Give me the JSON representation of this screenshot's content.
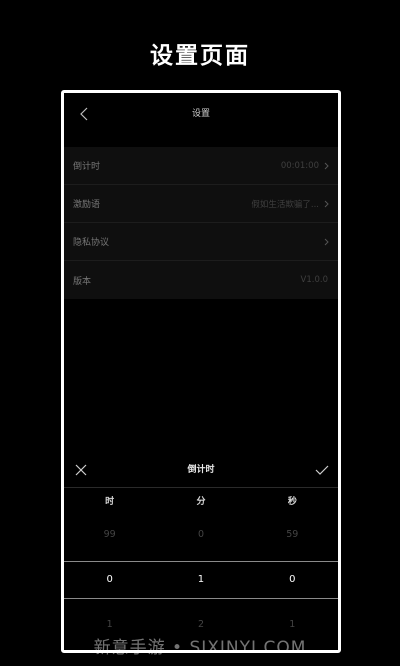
{
  "promo": {
    "title": "设置页面"
  },
  "nav": {
    "title": "设置"
  },
  "settings": [
    {
      "label": "倒计时",
      "value": "00:01:00",
      "arrow": true
    },
    {
      "label": "激励语",
      "value": "假如生活欺骗了...",
      "arrow": true
    },
    {
      "label": "隐私协议",
      "value": "",
      "arrow": true
    },
    {
      "label": "版本",
      "value": "V1.0.0",
      "arrow": false
    }
  ],
  "picker": {
    "title": "倒计时",
    "columns": [
      {
        "head": "时",
        "prev": "99",
        "current": "0",
        "next": "1"
      },
      {
        "head": "分",
        "prev": "0",
        "current": "1",
        "next": "2"
      },
      {
        "head": "秒",
        "prev": "59",
        "current": "0",
        "next": "1"
      }
    ]
  },
  "watermark": "新意手游 • SIXINYI.COM",
  "colors": {
    "background": "#000000",
    "row_background": "#0f0f0f",
    "frame": "#ffffff"
  },
  "icons": {
    "back": "chevron-left-icon",
    "close": "close-icon",
    "confirm": "check-icon",
    "row_arrow": "chevron-right-icon"
  }
}
